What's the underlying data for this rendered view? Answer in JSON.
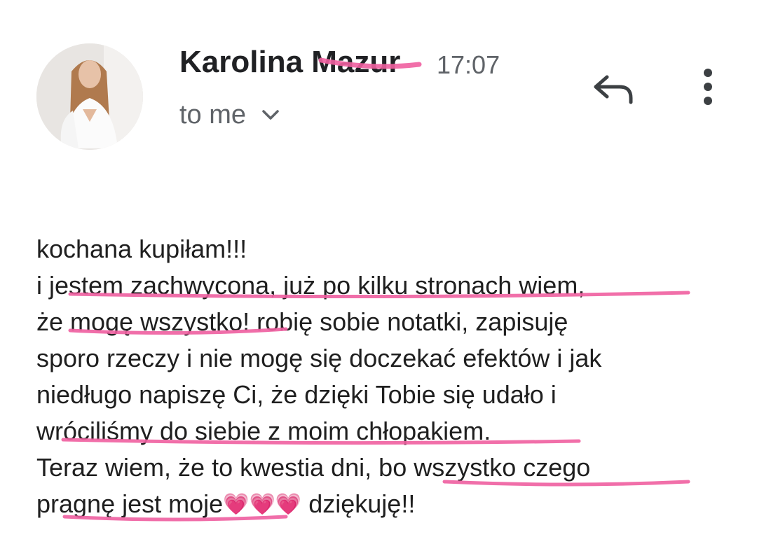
{
  "email": {
    "sender_name": "Karolina Mazur",
    "time": "17:07",
    "recipient": "to me",
    "body_lines": [
      "kochana kupiłam!!!",
      "i jestem zachwycona, już po kilku stronach wiem,",
      "że mogę wszystko! robię sobie notatki, zapisuję",
      "sporo rzeczy i nie mogę się doczekać efektów i jak",
      "niedługo napiszę Ci, że dzięki Tobie się udało i",
      "wróciliśmy do siebie z moim chłopakiem.",
      "Teraz wiem, że to kwestia dni, bo wszystko czego"
    ],
    "last_line_start": "pragnę jest moje",
    "hearts": "💗💗💗",
    "last_line_end": "dziękuję!!"
  },
  "icons": {
    "avatar": "avatar",
    "recipients_toggle": "chevron-down-icon",
    "reply": "reply-arrow-icon",
    "more": "more-vert-icon"
  },
  "colors": {
    "highlight_pink": "#ef5fa0",
    "heart_pink": "#f7b2d2",
    "secondary_text": "#5f6368",
    "primary_text": "#1f1f1f"
  }
}
